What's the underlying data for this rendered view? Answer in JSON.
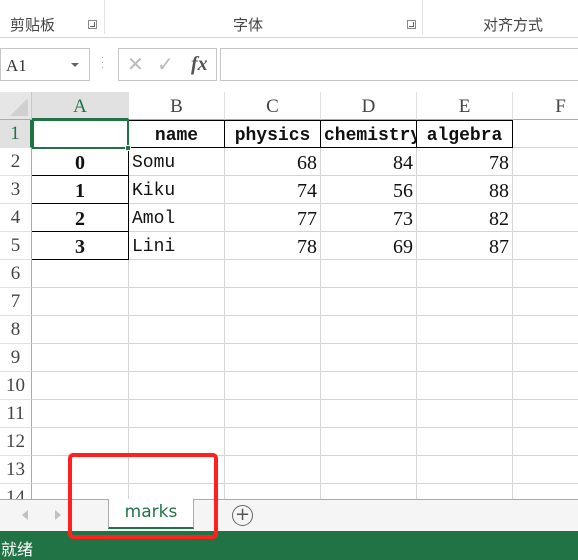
{
  "ribbon": {
    "groups": [
      {
        "label": "剪贴板",
        "has_launcher": true
      },
      {
        "label": "字体",
        "has_launcher": true
      },
      {
        "label": "对齐方式",
        "has_launcher": false
      }
    ]
  },
  "formula_bar": {
    "name_box": "A1",
    "cancel_icon": "✕",
    "enter_icon": "✓",
    "fx_label": "fx",
    "formula_value": ""
  },
  "grid": {
    "columns": [
      "A",
      "B",
      "C",
      "D",
      "E",
      "F"
    ],
    "active_column": "A",
    "rows": [
      "1",
      "2",
      "3",
      "4",
      "5",
      "6",
      "7",
      "8",
      "9",
      "10",
      "11",
      "12",
      "13",
      "14"
    ],
    "active_row": "1",
    "selected_cell": "A1",
    "header_row": [
      "",
      "name",
      "physics",
      "chemistry",
      "algebra"
    ],
    "data": [
      {
        "index": "0",
        "name": "Somu",
        "physics": "68",
        "chemistry": "84",
        "algebra": "78"
      },
      {
        "index": "1",
        "name": "Kiku",
        "physics": "74",
        "chemistry": "56",
        "algebra": "88"
      },
      {
        "index": "2",
        "name": "Amol",
        "physics": "77",
        "chemistry": "73",
        "algebra": "82"
      },
      {
        "index": "3",
        "name": "Lini",
        "physics": "78",
        "chemistry": "69",
        "algebra": "87"
      }
    ]
  },
  "sheets": {
    "tabs": [
      {
        "label": "marks",
        "active": true
      }
    ],
    "add_label": "+"
  },
  "status": {
    "text": "就绪"
  },
  "colors": {
    "accent": "#217346",
    "highlight": "#ff2020"
  }
}
